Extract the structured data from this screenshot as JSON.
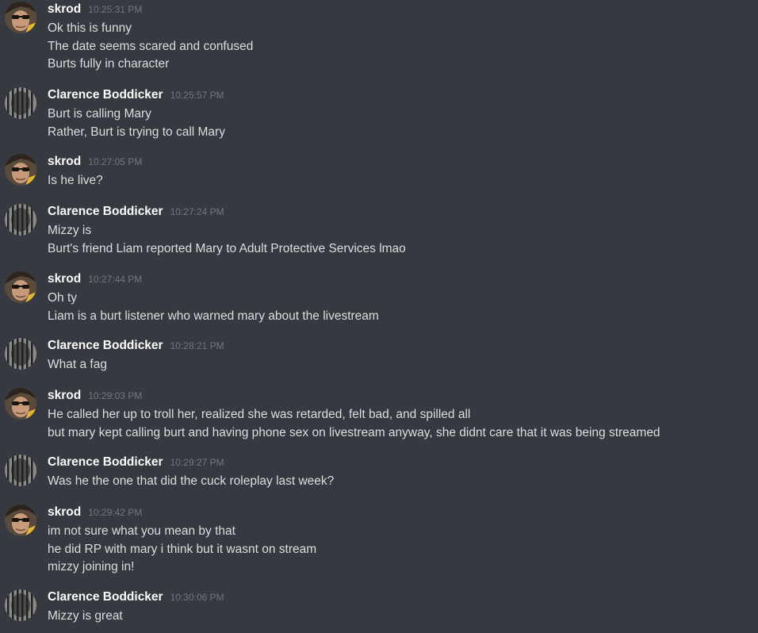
{
  "messages": [
    {
      "user": "skrod",
      "time": "10:25:31 PM",
      "avatar": "skrod-avatar",
      "lines": [
        "Ok this is funny",
        "The date seems scared and confused",
        "Burts fully in character"
      ]
    },
    {
      "user": "Clarence Boddicker",
      "time": "10:25:57 PM",
      "avatar": "clarence-avatar",
      "lines": [
        "Burt is calling Mary",
        "Rather, Burt is trying to call Mary"
      ]
    },
    {
      "user": "skrod",
      "time": "10:27:05 PM",
      "avatar": "skrod-avatar",
      "lines": [
        "Is he live?"
      ]
    },
    {
      "user": "Clarence Boddicker",
      "time": "10:27:24 PM",
      "avatar": "clarence-avatar",
      "lines": [
        "Mizzy is",
        "Burt's friend Liam reported Mary to Adult Protective Services lmao"
      ]
    },
    {
      "user": "skrod",
      "time": "10:27:44 PM",
      "avatar": "skrod-avatar",
      "lines": [
        "Oh ty",
        "Liam is a burt listener who warned mary about the livestream"
      ]
    },
    {
      "user": "Clarence Boddicker",
      "time": "10:28:21 PM",
      "avatar": "clarence-avatar",
      "lines": [
        "What a fag"
      ]
    },
    {
      "user": "skrod",
      "time": "10:29:03 PM",
      "avatar": "skrod-avatar",
      "lines": [
        "He called her up to troll her, realized she was retarded, felt bad, and spilled all",
        "but mary kept calling burt and having phone sex on livestream anyway, she didnt care that it was being streamed"
      ]
    },
    {
      "user": "Clarence Boddicker",
      "time": "10:29:27 PM",
      "avatar": "clarence-avatar",
      "lines": [
        "Was he the one that did the cuck roleplay last week?"
      ]
    },
    {
      "user": "skrod",
      "time": "10:29:42 PM",
      "avatar": "skrod-avatar",
      "lines": [
        "im not sure what you mean by that",
        "he did RP with mary i think but it wasnt on stream",
        "mizzy joining in!"
      ]
    },
    {
      "user": "Clarence Boddicker",
      "time": "10:30:06 PM",
      "avatar": "clarence-avatar",
      "lines": [
        "Mizzy is great"
      ]
    }
  ],
  "colors": {
    "background": "#36393f",
    "username": "#ffffff",
    "timestamp": "#72767d",
    "message_text": "#dcddde"
  }
}
